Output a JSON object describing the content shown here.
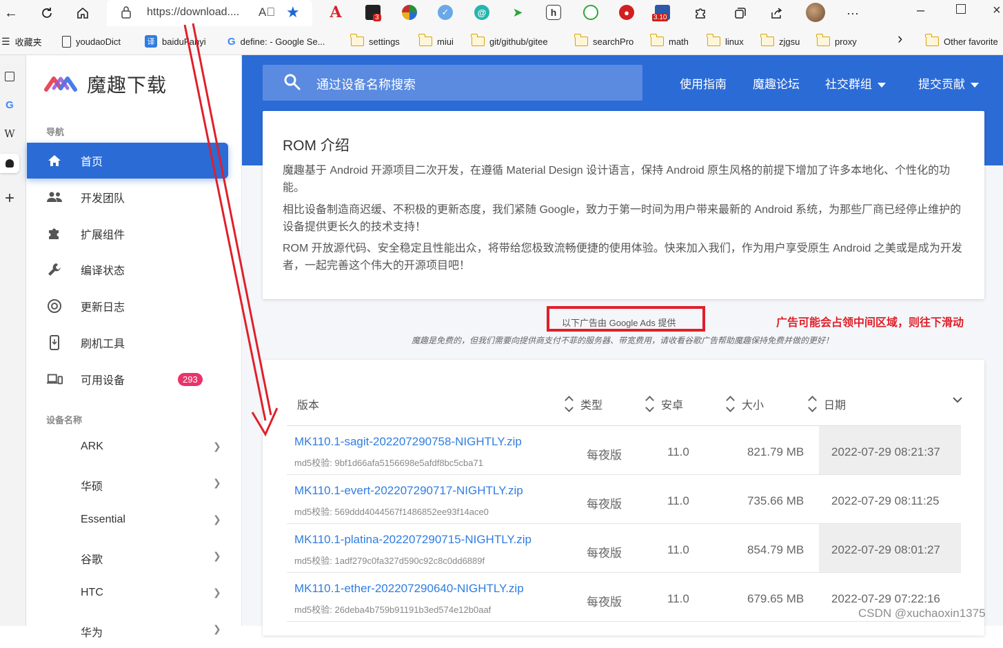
{
  "browser": {
    "url": "https://download....",
    "read_aloud": "A⃞",
    "ext_badge_count": "3",
    "ext_version_badge": "3.10",
    "menu_dots": "···"
  },
  "bookmarks": {
    "items": [
      {
        "label": "收藏夹",
        "icon": "favorites-icon"
      },
      {
        "label": "youdaoDict",
        "icon": "page-icon"
      },
      {
        "label": "baiduFanyi",
        "icon": "translate-icon"
      },
      {
        "label": "define: - Google Se...",
        "icon": "google-icon"
      },
      {
        "label": "settings",
        "icon": "folder-icon"
      },
      {
        "label": "miui",
        "icon": "folder-icon"
      },
      {
        "label": "git/github/gitee",
        "icon": "folder-icon"
      },
      {
        "label": "searchPro",
        "icon": "folder-icon"
      },
      {
        "label": "math",
        "icon": "folder-icon"
      },
      {
        "label": "linux",
        "icon": "folder-icon"
      },
      {
        "label": "zjgsu",
        "icon": "folder-icon"
      },
      {
        "label": "proxy",
        "icon": "folder-icon"
      }
    ],
    "more": "›",
    "other": "Other favorite"
  },
  "vtabs": {
    "g": "G",
    "w": "W",
    "plus": "+"
  },
  "site": {
    "logo_title": "魔趣下载",
    "nav_heading": "导航",
    "nav": [
      {
        "label": "首页",
        "icon": "home-icon"
      },
      {
        "label": "开发团队",
        "icon": "group-icon"
      },
      {
        "label": "扩展组件",
        "icon": "puzzle-icon"
      },
      {
        "label": "编译状态",
        "icon": "wrench-icon"
      },
      {
        "label": "更新日志",
        "icon": "history-icon"
      },
      {
        "label": "刷机工具",
        "icon": "phone-icon"
      },
      {
        "label": "可用设备",
        "icon": "devices-icon",
        "badge": "293"
      }
    ],
    "device_heading": "设备名称",
    "devices": [
      "ARK",
      "华硕",
      "Essential",
      "谷歌",
      "HTC",
      "华为"
    ]
  },
  "header": {
    "search_placeholder": "通过设备名称搜索",
    "links": [
      "使用指南",
      "魔趣论坛",
      "社交群组",
      "提交贡献"
    ]
  },
  "intro": {
    "title": "ROM 介绍",
    "p1": "魔趣基于 Android 开源项目二次开发，在遵循 Material Design 设计语言，保持 Android 原生风格的前提下增加了许多本地化、个性化的功能。",
    "p2": "相比设备制造商迟缓、不积极的更新态度，我们紧随 Google，致力于第一时间为用户带来最新的 Android 系统，为那些厂商已经停止维护的设备提供更长久的技术支持！",
    "p3": "ROM 开放源代码、安全稳定且性能出众，将带给您极致流畅便捷的使用体验。快来加入我们，作为用户享受原生 Android 之美或是成为开发者，一起完善这个伟大的开源项目吧！"
  },
  "ads": {
    "label": "以下广告由 Google Ads 提供",
    "annotation": "广告可能会占领中间区域，则往下滑动",
    "sub": "魔趣是免费的，但我们需要向提供商支付不菲的服务器、带宽费用，请收看谷歌广告帮助魔趣保持免费并做的更好！"
  },
  "table": {
    "headers": [
      "版本",
      "类型",
      "安卓",
      "大小",
      "日期"
    ],
    "rows": [
      {
        "name": "MK110.1-sagit-202207290758-NIGHTLY.zip",
        "md5": "md5校验: 9bf1d66afa5156698e5afdf8bc5cba71",
        "type": "每夜版",
        "android": "11.0",
        "size": "821.79 MB",
        "date": "2022-07-29 08:21:37"
      },
      {
        "name": "MK110.1-evert-202207290717-NIGHTLY.zip",
        "md5": "md5校验: 569ddd4044567f1486852ee93f14ace0",
        "type": "每夜版",
        "android": "11.0",
        "size": "735.66 MB",
        "date": "2022-07-29 08:11:25"
      },
      {
        "name": "MK110.1-platina-202207290715-NIGHTLY.zip",
        "md5": "md5校验: 1adf279c0fa327d590c92c8c0dd6889f",
        "type": "每夜版",
        "android": "11.0",
        "size": "854.79 MB",
        "date": "2022-07-29 08:01:27"
      },
      {
        "name": "MK110.1-ether-202207290640-NIGHTLY.zip",
        "md5": "md5校验: 26deba4b759b91191b3ed574e12b0aaf",
        "type": "每夜版",
        "android": "11.0",
        "size": "679.65 MB",
        "date": "2022-07-29 07:22:16"
      }
    ]
  },
  "watermark": "CSDN @xuchaoxin1375",
  "colors": {
    "brand": "#2b6bd6",
    "link": "#2f7de1",
    "badge": "#e9336b",
    "annotation": "#e01f2a"
  }
}
